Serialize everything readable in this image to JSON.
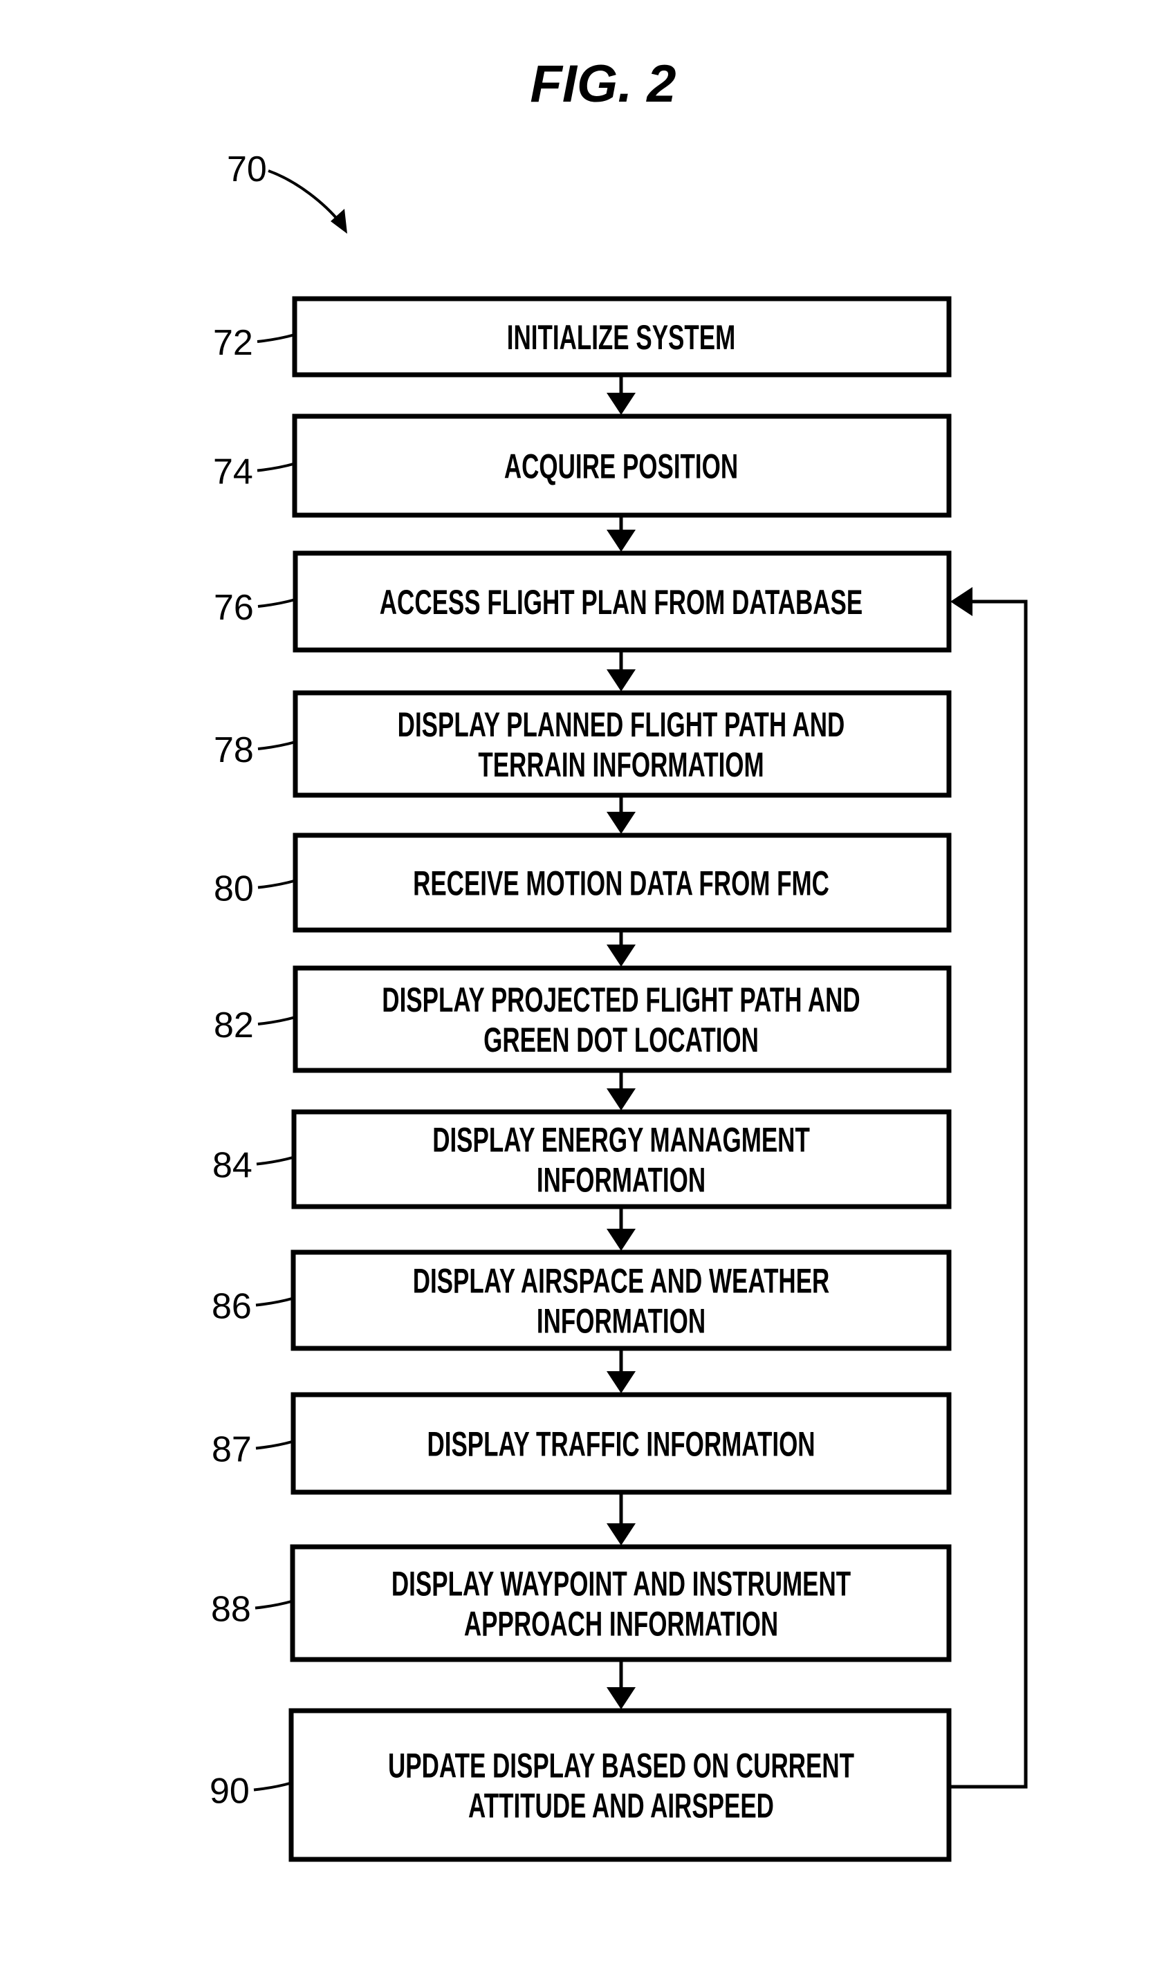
{
  "figure": {
    "title": "FIG. 2",
    "ref": "70"
  },
  "steps": [
    {
      "ref": "72",
      "lines": [
        "INITIALIZE SYSTEM"
      ]
    },
    {
      "ref": "74",
      "lines": [
        "ACQUIRE POSITION"
      ]
    },
    {
      "ref": "76",
      "lines": [
        "ACCESS FLIGHT PLAN FROM DATABASE"
      ]
    },
    {
      "ref": "78",
      "lines": [
        "DISPLAY PLANNED FLIGHT PATH AND",
        "TERRAIN INFORMATIOM"
      ]
    },
    {
      "ref": "80",
      "lines": [
        "RECEIVE MOTION DATA FROM FMC"
      ]
    },
    {
      "ref": "82",
      "lines": [
        "DISPLAY PROJECTED FLIGHT PATH AND",
        "GREEN DOT LOCATION"
      ]
    },
    {
      "ref": "84",
      "lines": [
        "DISPLAY ENERGY MANAGMENT",
        "INFORMATION"
      ]
    },
    {
      "ref": "86",
      "lines": [
        "DISPLAY AIRSPACE AND WEATHER",
        "INFORMATION"
      ]
    },
    {
      "ref": "87",
      "lines": [
        "DISPLAY TRAFFIC INFORMATION"
      ]
    },
    {
      "ref": "88",
      "lines": [
        "DISPLAY WAYPOINT AND INSTRUMENT",
        "APPROACH INFORMATION"
      ]
    },
    {
      "ref": "90",
      "lines": [
        "UPDATE DISPLAY BASED ON CURRENT",
        "ATTITUDE AND AIRSPEED"
      ]
    }
  ],
  "loop": {
    "from_step": "90",
    "to_step": "76"
  }
}
